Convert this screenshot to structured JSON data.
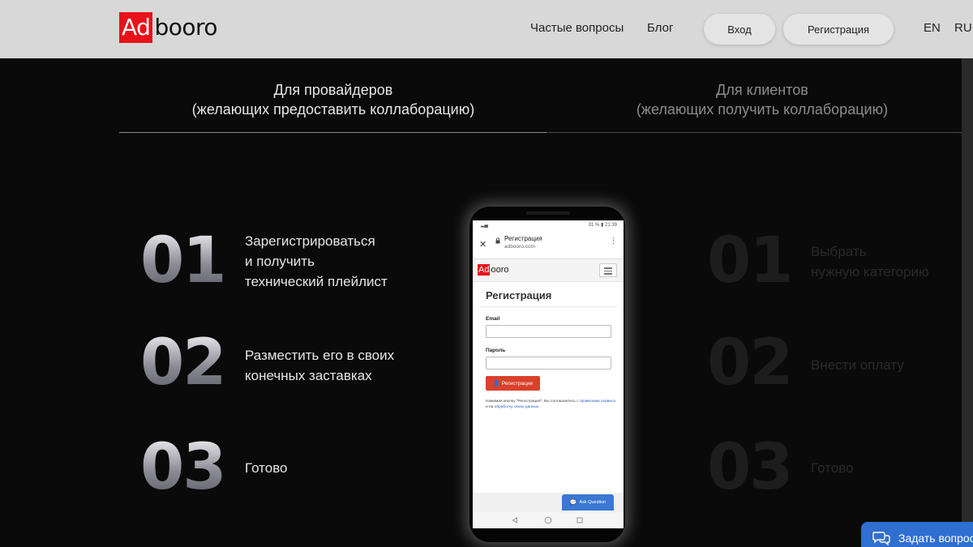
{
  "header": {
    "logo_ad": "Ad",
    "logo_rest": "booro",
    "nav": {
      "faq": "Частые вопросы",
      "blog": "Блог"
    },
    "login_label": "Вход",
    "register_label": "Регистрация",
    "lang_en": "EN",
    "lang_ru": "RU"
  },
  "tabs": [
    {
      "line1": "Для провайдеров",
      "line2": "(желающих предоставить коллаборацию)",
      "active": true
    },
    {
      "line1": "Для клиентов",
      "line2": "(желающих получить коллаборацию)",
      "active": false
    }
  ],
  "providers_steps": [
    {
      "num": "01",
      "line1": "Зарегистрироваться",
      "line2": "и получить",
      "line3": "технический плейлист"
    },
    {
      "num": "02",
      "line1": "Разместить его в своих",
      "line2": "конечных заставках"
    },
    {
      "num": "03",
      "line1": "Готово"
    }
  ],
  "clients_steps": [
    {
      "num": "01",
      "line1": "Выбрать",
      "line2": "нужную категорию"
    },
    {
      "num": "02",
      "line1": "Внести оплату"
    },
    {
      "num": "03",
      "line1": "Готово"
    }
  ],
  "phone": {
    "status_right": "31 % ▮ 21:39",
    "page_title": "Регистрация",
    "url": "adbooro.com",
    "logo_ad": "Ad",
    "logo_rest": "ooro",
    "heading": "Регистрация",
    "email_label": "Email",
    "password_label": "Пароль",
    "submit_label": "Регистрация",
    "terms_p1": "Нажимая кнопку \"Регистрация\", Вы соглашаетесь с ",
    "terms_link1": "правилами сервиса",
    "terms_p2": " и на ",
    "terms_link2": "обработку своих данных",
    "terms_p3": ".",
    "ask_label": "Ask Question"
  },
  "help_widget": {
    "label": "Задать вопрос"
  },
  "colors": {
    "header_bg": "#d8d8d8",
    "page_bg": "#0a0a0a",
    "brand_red": "#e8121a",
    "help_blue": "#2f6fd0",
    "phone_button_red": "#d9412b"
  },
  "icons": [
    "close-icon",
    "lock-icon",
    "menu-icon",
    "chat-icon",
    "user-plus-icon",
    "back-icon",
    "home-icon",
    "recents-icon"
  ]
}
